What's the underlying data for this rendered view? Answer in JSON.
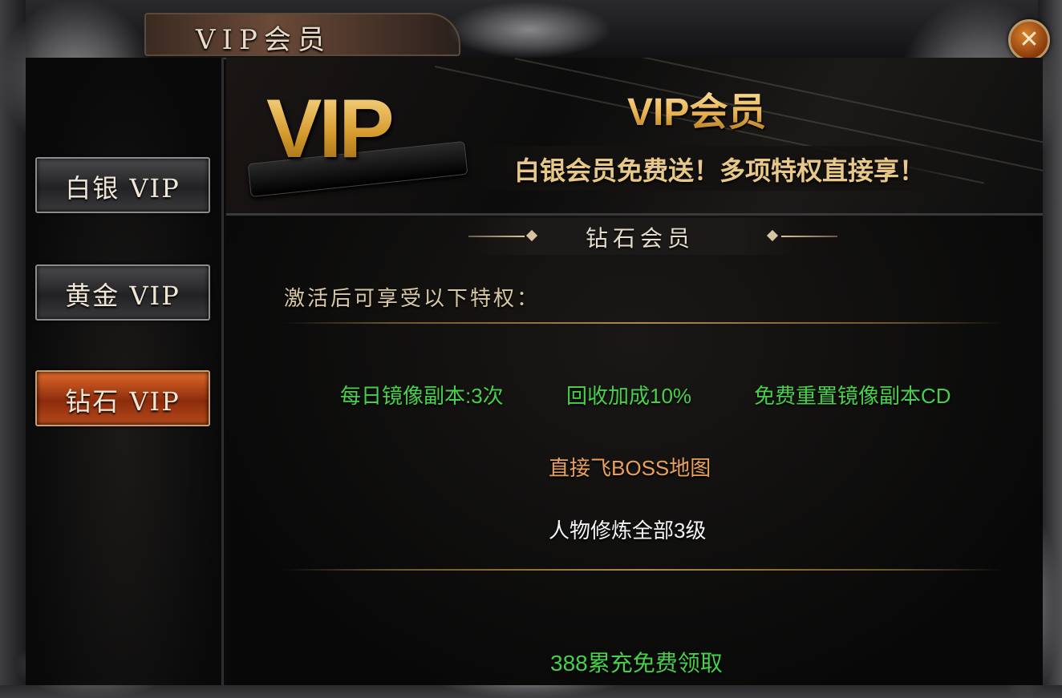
{
  "window": {
    "title": "VIP会员",
    "close_symbol": "✕"
  },
  "sidebar": {
    "items": [
      {
        "label": "白银 VIP",
        "active": false
      },
      {
        "label": "黄金 VIP",
        "active": false
      },
      {
        "label": "钻石 VIP",
        "active": true
      }
    ]
  },
  "banner": {
    "logo": "VIP",
    "title": "VIP会员",
    "subtitle": "白银会员免费送！多项特权直接享！"
  },
  "content": {
    "section_title": "钻石会员",
    "intro": "激活后可享受以下特权：",
    "perks": [
      {
        "text": "每日镜像副本:3次",
        "color": "#48d04a"
      },
      {
        "text": "回收加成10%",
        "color": "#48d04a"
      },
      {
        "text": "免费重置镜像副本CD",
        "color": "#48d04a"
      },
      {
        "text": "直接飞BOSS地图",
        "color": "#e8a05c"
      },
      {
        "text": "人物修炼全部3级",
        "color": "#f4f4f4"
      }
    ],
    "claim_label": "388累充免费领取"
  },
  "icons": {
    "close": "close-icon",
    "ornament": "dragon-ornament-icon"
  }
}
